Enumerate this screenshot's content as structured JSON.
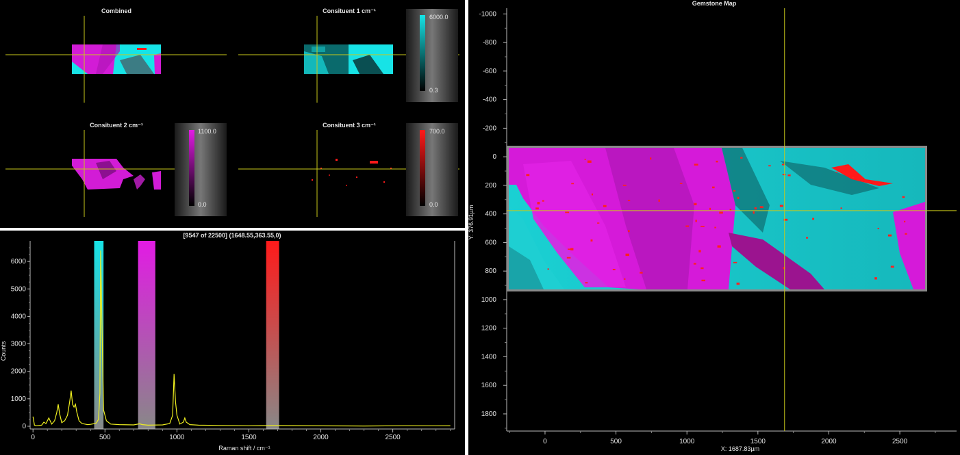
{
  "colors": {
    "background": "#000000",
    "divider": "#ffffff",
    "crosshair": "#c8c81a",
    "cyan": "#17e3e6",
    "magenta": "#e21be4",
    "red": "#ff1a1a",
    "spectrum": "#f0f020"
  },
  "maps": {
    "combined": {
      "title": "Combined"
    },
    "c1": {
      "title": "Consituent 1 cm⁻¹",
      "scale_max": "6000.0",
      "scale_min": "0.3"
    },
    "c2": {
      "title": "Consituent 2 cm⁻¹",
      "scale_max": "1100.0",
      "scale_min": "0.0"
    },
    "c3": {
      "title": "Consituent 3 cm⁻¹",
      "scale_max": "700.0",
      "scale_min": "0.0"
    }
  },
  "spectrum": {
    "title": "[9547 of 22500] (1648.55,363.55,0)",
    "bands": [
      {
        "name": "constituent-1-band",
        "from": 425,
        "to": 490,
        "color": "#17e3e6"
      },
      {
        "name": "constituent-2-band",
        "from": 730,
        "to": 850,
        "color": "#e21be4"
      },
      {
        "name": "constituent-3-band",
        "from": 1620,
        "to": 1710,
        "color": "#ff1a1a"
      }
    ]
  },
  "chart_data": [
    {
      "type": "line",
      "xlabel": "Raman shift / cm⁻¹",
      "ylabel": "Counts",
      "xlim": [
        -20,
        2930
      ],
      "ylim": [
        -100,
        6750
      ],
      "x_ticks": [
        0,
        500,
        1000,
        1500,
        2000,
        2500
      ],
      "y_ticks": [
        0,
        1000,
        2000,
        3000,
        4000,
        5000,
        6000
      ],
      "series": [
        {
          "x": [
            0,
            10,
            20,
            40,
            60,
            75,
            90,
            110,
            130,
            150,
            165,
            175,
            185,
            200,
            220,
            240,
            255,
            265,
            275,
            285,
            295,
            305,
            320,
            340,
            360,
            380,
            400,
            420,
            440,
            455,
            465,
            470,
            478,
            490,
            510,
            540,
            600,
            700,
            740,
            760,
            800,
            900,
            950,
            970,
            980,
            990,
            1000,
            1020,
            1045,
            1055,
            1065,
            1090,
            1150,
            1300,
            1500,
            1700,
            2000,
            2300,
            2600,
            2900
          ],
          "y": [
            350,
            40,
            20,
            30,
            40,
            150,
            100,
            300,
            80,
            200,
            500,
            800,
            450,
            130,
            200,
            400,
            900,
            1300,
            800,
            700,
            800,
            500,
            200,
            100,
            80,
            60,
            70,
            90,
            120,
            250,
            1200,
            6400,
            4000,
            600,
            200,
            80,
            60,
            50,
            90,
            60,
            40,
            50,
            100,
            400,
            1900,
            900,
            400,
            80,
            150,
            300,
            150,
            60,
            40,
            30,
            20,
            25,
            15,
            10,
            20,
            15
          ]
        }
      ]
    },
    {
      "type": "heatmap",
      "title": "Gemstone Map",
      "xlabel": "X: 1687.83µm",
      "ylabel": "Y: 376.91µm",
      "x_ticks": [
        0,
        500,
        1000,
        1500,
        2000,
        2500
      ],
      "y_ticks": [
        -1000,
        -800,
        -600,
        -400,
        -200,
        0,
        200,
        400,
        600,
        800,
        1000,
        1200,
        1400,
        1600,
        1800
      ],
      "xlim": [
        -270,
        2900
      ],
      "ylim": [
        -1040,
        1920
      ],
      "sample_extent": {
        "x": [
          -260,
          2700
        ],
        "y": [
          -70,
          930
        ]
      },
      "crosshair": {
        "x": 1687.83,
        "y": 376.91
      }
    }
  ]
}
